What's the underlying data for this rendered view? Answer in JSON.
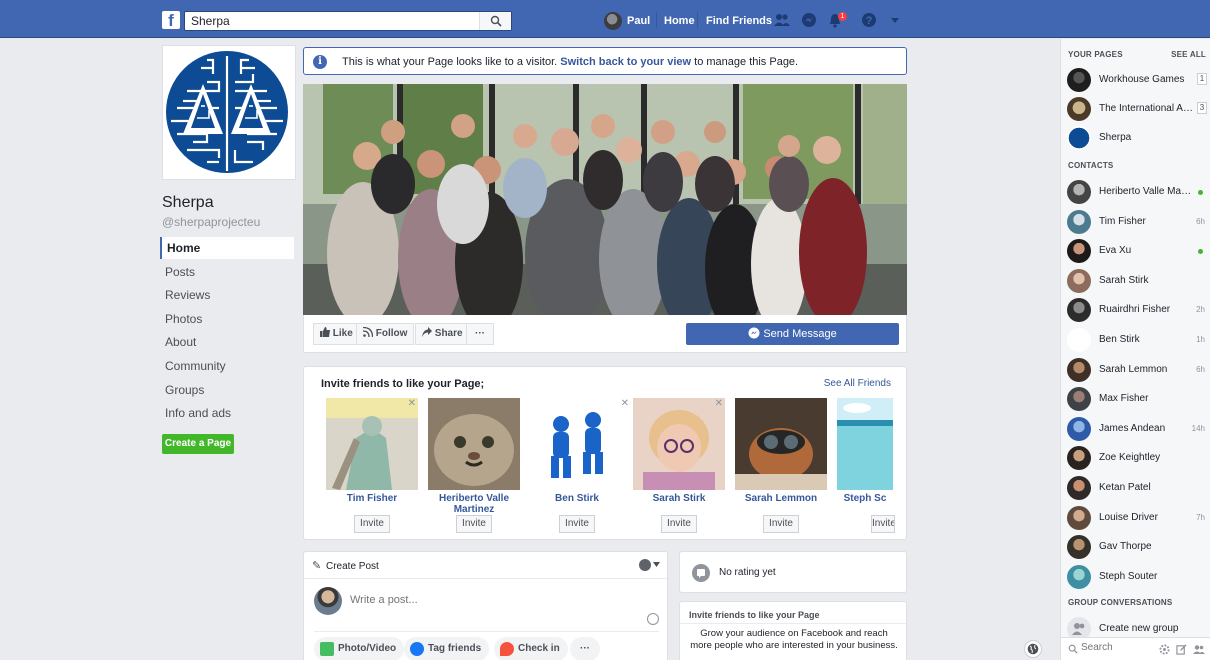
{
  "topbar": {
    "logo": "f",
    "search_value": "Sherpa",
    "user_name": "Paul",
    "home": "Home",
    "find_friends": "Find Friends",
    "notification_count": "1"
  },
  "page": {
    "name": "Sherpa",
    "handle": "@sherpaprojecteu"
  },
  "left_nav": [
    "Home",
    "Posts",
    "Reviews",
    "Photos",
    "About",
    "Community",
    "Groups",
    "Info and ads"
  ],
  "create_page_label": "Create a Page",
  "banner": {
    "text_before": "This is what your Page looks like to a visitor. ",
    "link": "Switch back to your view",
    "text_after": " to manage this Page."
  },
  "cover_actions": {
    "like": "Like",
    "follow": "Follow",
    "share": "Share",
    "more": "···",
    "send_message": "Send Message"
  },
  "invite": {
    "title": "Invite friends to like your Page;",
    "see_all": "See All Friends",
    "button": "Invite",
    "friends": [
      "Tim Fisher",
      "Heriberto Valle Martinez",
      "Ben Stirk",
      "Sarah Stirk",
      "Sarah Lemmon",
      "Steph Sc"
    ]
  },
  "create_post": {
    "title": "Create Post",
    "placeholder": "Write a post...",
    "photo_video": "Photo/Video",
    "tag_friends": "Tag friends",
    "check_in": "Check in",
    "more": "···"
  },
  "rating": {
    "text": "No rating yet"
  },
  "invite_like": {
    "title": "Invite friends to like your Page",
    "description": "Grow your audience on Facebook and reach more people who are interested in your business."
  },
  "sidebar": {
    "your_pages_heading": "YOUR PAGES",
    "see_all": "SEE ALL",
    "pages": [
      {
        "name": "Workhouse Games",
        "count": "1"
      },
      {
        "name": "The International Aco...",
        "count": "3"
      },
      {
        "name": "Sherpa",
        "count": ""
      }
    ],
    "contacts_heading": "CONTACTS",
    "contacts": [
      {
        "name": "Heriberto Valle Martinez",
        "meta": "",
        "online": true
      },
      {
        "name": "Tim Fisher",
        "meta": "6h",
        "online": false
      },
      {
        "name": "Eva Xu",
        "meta": "",
        "online": true
      },
      {
        "name": "Sarah Stirk",
        "meta": "",
        "online": false
      },
      {
        "name": "Ruairdhri Fisher",
        "meta": "2h",
        "online": false
      },
      {
        "name": "Ben Stirk",
        "meta": "1h",
        "online": false
      },
      {
        "name": "Sarah Lemmon",
        "meta": "6h",
        "online": false
      },
      {
        "name": "Max Fisher",
        "meta": "",
        "online": false
      },
      {
        "name": "James Andean",
        "meta": "14h",
        "online": false
      },
      {
        "name": "Zoe Keightley",
        "meta": "",
        "online": false
      },
      {
        "name": "Ketan Patel",
        "meta": "",
        "online": false
      },
      {
        "name": "Louise Driver",
        "meta": "7h",
        "online": false
      },
      {
        "name": "Gav Thorpe",
        "meta": "",
        "online": false
      },
      {
        "name": "Steph Souter",
        "meta": "",
        "online": false
      }
    ],
    "group_heading": "GROUP CONVERSATIONS",
    "create_group": "Create new group",
    "search_placeholder": "Search"
  },
  "colors": {
    "brand": "#4267b2",
    "online": "#42b72a",
    "link": "#365899"
  }
}
